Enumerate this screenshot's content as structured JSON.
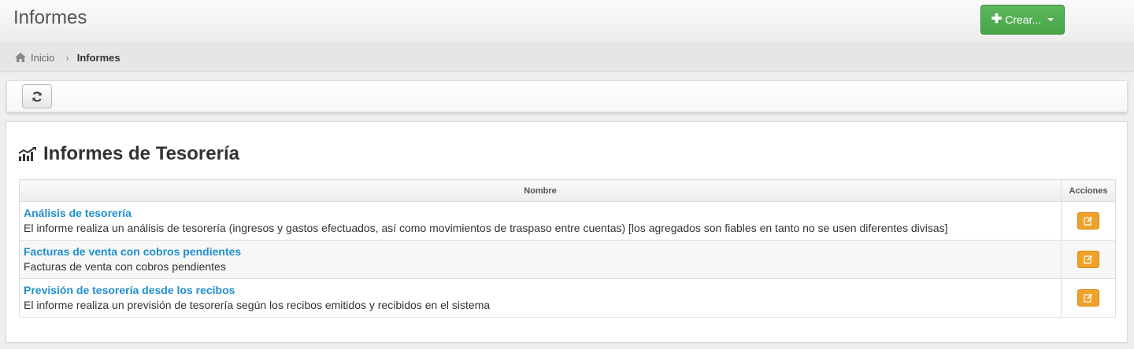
{
  "header": {
    "title": "Informes",
    "create_label": "Crear..."
  },
  "breadcrumb": {
    "home": "Inicio",
    "current": "Informes"
  },
  "toolbar": {
    "refresh_icon": "refresh-icon"
  },
  "section": {
    "title": "Informes de Tesorería",
    "icon": "bar-chart-icon"
  },
  "table": {
    "columns": [
      "Nombre",
      "Acciones"
    ],
    "rows": [
      {
        "title": "Análisis de tesorería",
        "description": "El informe realiza un análisis de tesorería (ingresos y gastos efectuados, así como movimientos de traspaso entre cuentas) [los agregados son fiables en tanto no se usen diferentes divisas]"
      },
      {
        "title": "Facturas de venta con cobros pendientes",
        "description": "Facturas de venta con cobros pendientes"
      },
      {
        "title": "Previsión de tesorería desde los recibos",
        "description": "El informe realiza un previsión de tesorería según los recibos emitidos y recibidos en el sistema"
      }
    ]
  },
  "colors": {
    "primary_green": "#5cb85c",
    "link_blue": "#1f8fce",
    "edit_orange": "#f0a12a"
  }
}
